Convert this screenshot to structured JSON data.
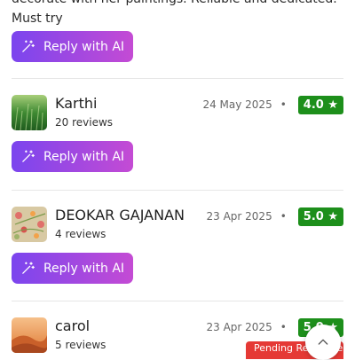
{
  "previous_review": {
    "text": "decorate with her paintings. Reliable and dedicated. Must try",
    "reply_label": "Reply with AI"
  },
  "reviews": [
    {
      "name": "Karthi",
      "review_count": "20 reviews",
      "date": "24 May 2025",
      "separator": "•",
      "rating": "4.0 ★",
      "reply_label": "Reply with AI"
    },
    {
      "name": "DEOKAR GAJANAN",
      "review_count": "4 reviews",
      "date": "23 Apr 2025",
      "separator": "•",
      "rating": "5.0 ★",
      "reply_label": "Reply with AI"
    },
    {
      "name": "carol",
      "review_count": "5 reviews",
      "date": "23 Apr 2025",
      "separator": "•",
      "rating": "5.0 ★",
      "status_badge": "Pending Response"
    }
  ],
  "colors": {
    "button_gradient_start": "#7b45ee",
    "button_gradient_end": "#c44bd4",
    "rating_badge": "#1d8f1b",
    "pending_badge": "#e53935"
  },
  "icons": {
    "reply": "magic-wand-icon",
    "scroll": "chevron-up-icon"
  }
}
